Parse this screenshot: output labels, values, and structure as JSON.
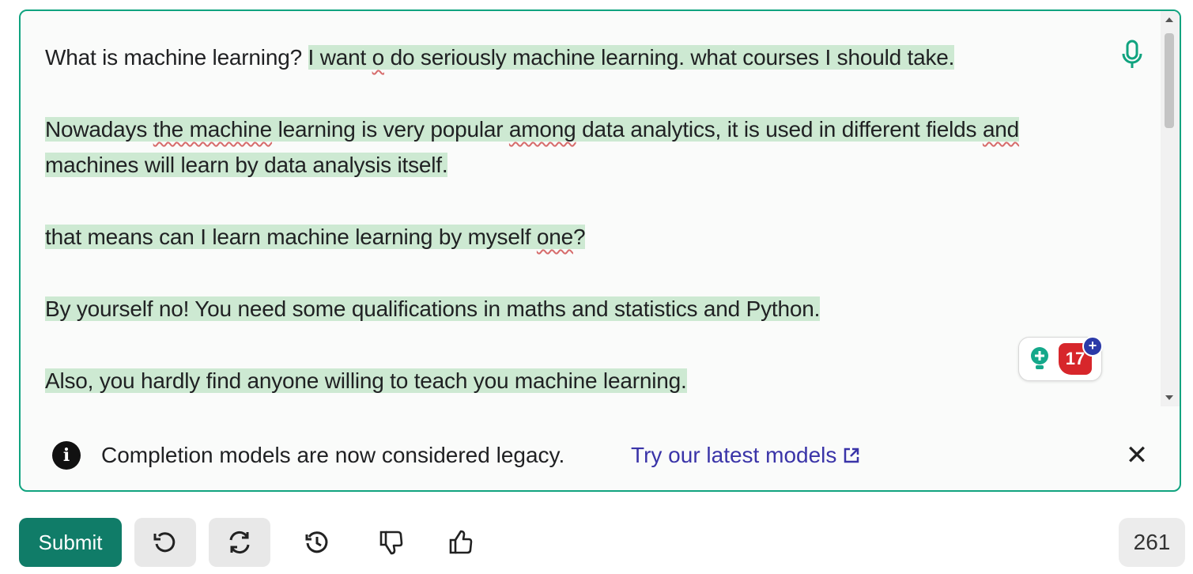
{
  "editor": {
    "paragraphs": [
      {
        "segments": [
          {
            "text": "What is machine learning? ",
            "highlight": false,
            "spell": false
          },
          {
            "text": "I want ",
            "highlight": true,
            "spell": false
          },
          {
            "text": "o",
            "highlight": true,
            "spell": true
          },
          {
            "text": " do seriously machine learning. what courses I should take.",
            "highlight": true,
            "spell": false
          }
        ]
      },
      {
        "segments": [
          {
            "text": "Nowadays ",
            "highlight": true,
            "spell": false
          },
          {
            "text": "the machine",
            "highlight": true,
            "spell": true
          },
          {
            "text": " learning is very popular ",
            "highlight": true,
            "spell": false
          },
          {
            "text": "among",
            "highlight": true,
            "spell": true
          },
          {
            "text": " data analytics, it is used in different fields ",
            "highlight": true,
            "spell": false
          },
          {
            "text": "and",
            "highlight": true,
            "spell": true
          },
          {
            "text": " machines will learn by data analysis itself.",
            "highlight": true,
            "spell": false
          }
        ]
      },
      {
        "segments": [
          {
            "text": "that means can I learn machine learning by myself ",
            "highlight": true,
            "spell": false
          },
          {
            "text": "one",
            "highlight": true,
            "spell": true
          },
          {
            "text": "?",
            "highlight": true,
            "spell": false
          }
        ]
      },
      {
        "segments": [
          {
            "text": "By yourself no! You need some qualifications in maths and statistics and Python.",
            "highlight": true,
            "spell": false
          }
        ]
      },
      {
        "segments": [
          {
            "text": "Also, you hardly find anyone willing to teach you machine learning.",
            "highlight": true,
            "spell": false
          }
        ]
      }
    ],
    "mic_icon": "microphone-icon",
    "extension": {
      "count": "17",
      "plus": "+",
      "icons": [
        "lightbulb-icon",
        "grammar-badge-icon",
        "plus-icon"
      ]
    }
  },
  "notice": {
    "icon": "info-icon",
    "icon_glyph": "i",
    "text": "Completion models are now considered legacy.",
    "link_text": "Try our latest models",
    "close_glyph": "✕"
  },
  "toolbar": {
    "submit_label": "Submit",
    "buttons": [
      "undo-icon",
      "regenerate-icon",
      "history-icon",
      "thumbs-down-icon",
      "thumbs-up-icon"
    ],
    "token_count": "261"
  },
  "colors": {
    "accent": "#10a37f",
    "submit": "#107c68",
    "highlight": "#cde9d2",
    "link": "#3a34a8",
    "spell_underline": "#d66b6b"
  }
}
